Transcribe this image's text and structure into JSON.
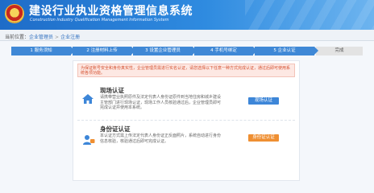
{
  "header": {
    "title": "建设行业执业资格管理信息系统",
    "subtitle": "Construction Industry Qualification Management Information System"
  },
  "breadcrumb": {
    "prefix": "当前位置：",
    "level1": "企业管理员",
    "separator": ">",
    "level2": "企业注册"
  },
  "steps": [
    {
      "label": "1 服务须知",
      "state": "done"
    },
    {
      "label": "2 注册材料上传",
      "state": "done"
    },
    {
      "label": "3 设置企业管理员",
      "state": "done"
    },
    {
      "label": "4 手机号绑定",
      "state": "done"
    },
    {
      "label": "5 企业认证",
      "state": "done"
    },
    {
      "label": "完成",
      "state": "pending"
    }
  ],
  "notice": "为保证账号安全和身份真实性，企业管理员需进行实名认证，请您选择以下任意一种方式完成认证，通过后即可使用系统各项功能。",
  "cards": [
    {
      "title": "现场认证",
      "desc": "请携带营业执照原件及法定代表人身份证原件到当地住房和城乡建设主管部门进行现场认证，现场工作人员核验通过后，企业管理员即可完成认证并使用本系统。",
      "button": "现场认证",
      "icon": "house-icon",
      "accent": "#3d86d8"
    },
    {
      "title": "身份证认证",
      "desc": "本认证方式需上传法定代表人身份证正反面照片，系统自动进行身份信息核验，核验通过后即可完成认证。",
      "button": "身份证认证",
      "icon": "user-id-icon",
      "accent": "#ef8f32"
    }
  ],
  "colors": {
    "header_start": "#1e6cc8",
    "step_done": "#3f88d6",
    "notice_text": "#d4502f",
    "button_blue": "#3d86d8",
    "button_orange": "#ef8f32"
  }
}
